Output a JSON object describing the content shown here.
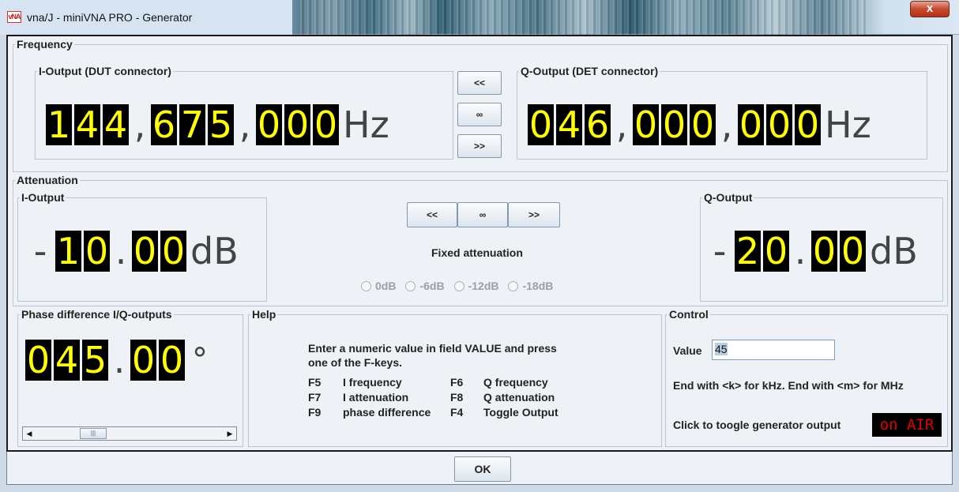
{
  "window": {
    "title": "vna/J - miniVNA PRO - Generator",
    "icon_text": "vNA",
    "close_glyph": "x"
  },
  "frequency": {
    "group_title": "Frequency",
    "i_output": {
      "title": "I-Output (DUT connector)",
      "digits": [
        "1",
        "4",
        "4",
        ",",
        "6",
        "7",
        "5",
        ",",
        "0",
        "0",
        "0"
      ],
      "unit": "Hz"
    },
    "q_output": {
      "title": "Q-Output (DET connector)",
      "digits": [
        "0",
        "4",
        "6",
        ",",
        "0",
        "0",
        "0",
        ",",
        "0",
        "0",
        "0"
      ],
      "unit": "Hz"
    },
    "buttons": {
      "left": "<<",
      "mid": "∞",
      "right": ">>"
    }
  },
  "attenuation": {
    "group_title": "Attenuation",
    "i_output": {
      "title": "I-Output",
      "sign": "-",
      "digits": [
        "1",
        "0",
        ".",
        "0",
        "0"
      ],
      "unit": "dB"
    },
    "q_output": {
      "title": "Q-Output",
      "sign": "-",
      "digits": [
        "2",
        "0",
        ".",
        "0",
        "0"
      ],
      "unit": "dB"
    },
    "buttons": {
      "left": "<<",
      "mid": "∞",
      "right": ">>"
    },
    "fixed_label": "Fixed attenuation",
    "radios": [
      "0dB",
      "-6dB",
      "-12dB",
      "-18dB"
    ]
  },
  "phase": {
    "title": "Phase difference I/Q-outputs",
    "digits": [
      "0",
      "4",
      "5",
      ".",
      "0",
      "0"
    ],
    "unit": "°"
  },
  "help": {
    "title": "Help",
    "line1": "Enter a numeric value in field VALUE and press",
    "line2": "one of the F-keys.",
    "rows": [
      {
        "k1": "F5",
        "d1": "I  frequency",
        "k2": "F6",
        "d2": "Q frequency"
      },
      {
        "k1": "F7",
        "d1": "I attenuation",
        "k2": "F8",
        "d2": "Q attenuation"
      },
      {
        "k1": "F9",
        "d1": "phase difference",
        "k2": "F4",
        "d2": "Toggle Output"
      }
    ]
  },
  "control": {
    "title": "Control",
    "value_label": "Value",
    "value": "45",
    "hint": "End with <k> for kHz. End with <m> for MHz",
    "toggle_label": "Click to toogle generator output",
    "onair_text": "on AIR"
  },
  "ok_label": "OK"
}
